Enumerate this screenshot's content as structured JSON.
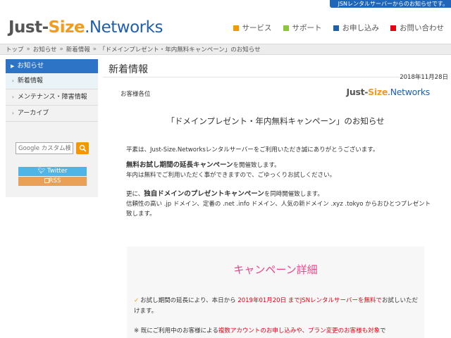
{
  "topbar": {
    "notice": "JSNレンタルサーバーからのお知らせです。"
  },
  "logo": {
    "part1": "Just-",
    "part2": "Size",
    "part3": ".Networks"
  },
  "gnav": [
    {
      "label": "サービス",
      "color": "#f39800"
    },
    {
      "label": "サポート",
      "color": "#8cc63f"
    },
    {
      "label": "お申し込み",
      "color": "#1f5fab"
    },
    {
      "label": "お問い合わせ",
      "color": "#e60012"
    }
  ],
  "breadcrumb": [
    "トップ",
    "お知らせ",
    "新着情報",
    "「ドメインプレゼント・年内無料キャンペーン」のお知らせ"
  ],
  "sidebar": {
    "header": "お知らせ",
    "items": [
      "新着情報",
      "メンテナンス・障害情報",
      "アーカイブ"
    ],
    "search_placeholder": "Google カスタム検索",
    "twitter": "Twitter",
    "rss": "RSS"
  },
  "main": {
    "title": "新着情報",
    "date": "2018年11月28日",
    "greeting": "お客様各位",
    "headline": "「ドメインプレゼント・年内無料キャンペーン」のお知らせ",
    "p1": "平素は、Just-Size.Networksレンタルサーバーをご利用いただき誠にありがとうございます。",
    "p2_bold": "無料お試し期間の延長キャンペーン",
    "p2_rest": "を開催致します。",
    "p2_line2": "年内は無料でご利用いただく事ができますので、ごゆっくりお試しください。",
    "p3_prefix": "更に、",
    "p3_bold": "独自ドメインのプレゼントキャンペーン",
    "p3_rest": "を同時開催致します。",
    "p3_line2": "信頼性の高い .jp ドメイン、定番の .net .info ドメイン、人気の新ドメイン .xyz .tokyo からおひとつプレゼント致します。"
  },
  "campaign": {
    "title": "キャンペーン詳細",
    "line1_a": "お試し期間の延長により、本日から ",
    "line1_red": "2019年01月20日 までJSNレンタルサーバーを無料で",
    "line1_b": "お試しいただけます。",
    "line2_a": "※ 既にご利用中のお客様による",
    "line2_red": "複数アカウントのお申し込みや、プラン変更のお客様も対象",
    "line2_b": "で"
  }
}
